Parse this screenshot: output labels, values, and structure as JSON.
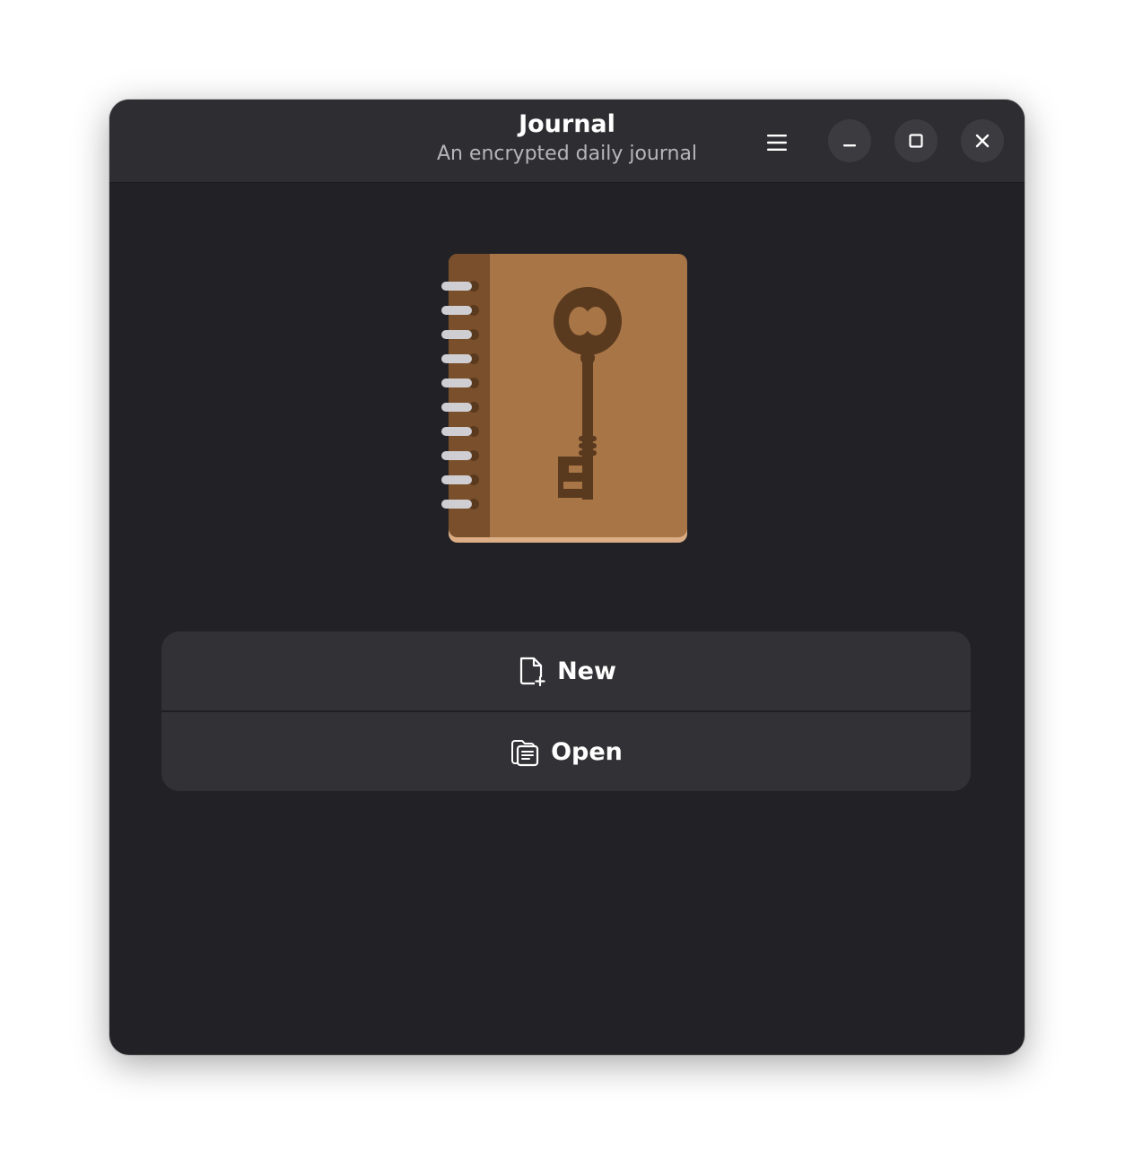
{
  "window": {
    "title": "Journal",
    "subtitle": "An encrypted daily journal"
  },
  "header_controls": {
    "menu_icon": "hamburger-menu-icon",
    "minimize_icon": "minimize-icon",
    "maximize_icon": "maximize-icon",
    "close_icon": "close-icon"
  },
  "illustration": {
    "icon": "journal-with-key-icon"
  },
  "actions": [
    {
      "label": "New",
      "icon": "new-document-icon"
    },
    {
      "label": "Open",
      "icon": "open-documents-icon"
    }
  ],
  "colors": {
    "window_bg": "#222226",
    "headerbar_bg": "#2e2e32",
    "card_bg": "#323236",
    "book_cover": "#a87547",
    "book_spine": "#7a4f2c",
    "key": "#5a3a1e"
  }
}
